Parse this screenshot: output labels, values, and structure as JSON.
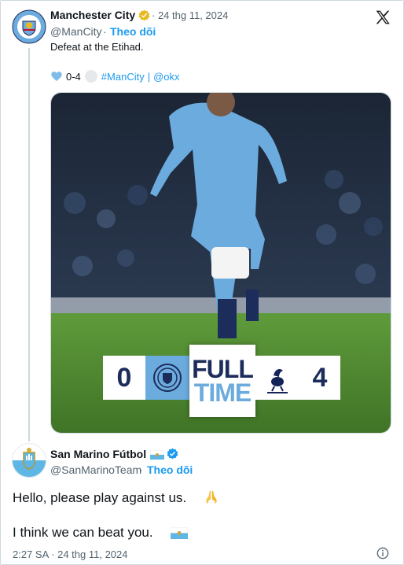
{
  "original_tweet": {
    "display_name": "Manchester City",
    "date": "· 24 thg 11, 2024",
    "handle": "@ManCity",
    "dot": "·",
    "follow_label": "Theo dõi",
    "text": "Defeat at the Etihad.",
    "tag_score": "0-4",
    "hashtag": "#ManCity",
    "separator": "|",
    "mention": "@okx",
    "verified_badge_color": "#e8b923"
  },
  "media": {
    "scoreboard": {
      "home_score": "0",
      "full": "FULL",
      "time": "TIME",
      "away_score": "4"
    },
    "pitch_color": "#4e8a2e",
    "kit_color": "#6cabdd"
  },
  "reply": {
    "display_name": "San Marino Fútbol",
    "handle": "@SanMarinoTeam",
    "dot": "·",
    "follow_label": "Theo dõi",
    "line1": "Hello, please play against us.",
    "line2": "I think we can beat you.",
    "timestamp": "2:27 SA · 24 thg 11, 2024",
    "verified_badge_color": "#1d9bf0"
  },
  "icons": {
    "x_logo": "x-logo-icon",
    "heart": "heart-icon",
    "pray": "praying-hands-icon",
    "flag": "san-marino-flag-icon",
    "info": "info-icon"
  },
  "accent_color": "#1d9bf0"
}
